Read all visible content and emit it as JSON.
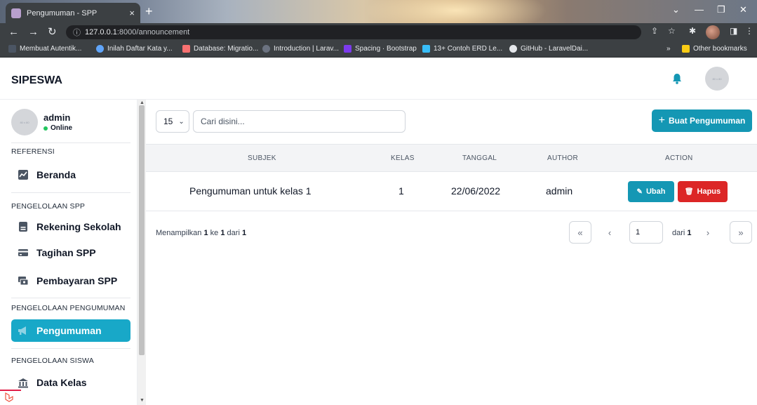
{
  "browser": {
    "tab_title": "Pengumuman - SPP",
    "tab_close": "×",
    "new_tab": "+",
    "url_host": "127.0.0.1",
    "url_path": ":8000/announcement",
    "bookmarks": [
      "Membuat Autentik...",
      "Inilah Daftar Kata y...",
      "Database: Migratio...",
      "Introduction | Larav...",
      "Spacing · Bootstrap",
      "13+ Contoh ERD Le...",
      "GitHub - LaravelDai..."
    ],
    "bookmarks_more": "»",
    "other_bookmarks": "Other bookmarks"
  },
  "app": {
    "brand": "SIPESWA",
    "avatar_text": "80 x 80"
  },
  "sidebar": {
    "user_name": "admin",
    "user_status": "Online",
    "sections": [
      {
        "title": "REFERENSI"
      },
      {
        "title": "PENGELOLAAN SPP"
      },
      {
        "title": "PENGELOLAAN PENGUMUMAN"
      },
      {
        "title": "PENGELOLAAN SISWA"
      }
    ],
    "items": [
      {
        "label": "Beranda",
        "icon": "chart-icon"
      },
      {
        "label": "Rekening Sekolah",
        "icon": "document-icon"
      },
      {
        "label": "Tagihan SPP",
        "icon": "card-icon"
      },
      {
        "label": "Pembayaran SPP",
        "icon": "payment-icon"
      },
      {
        "label": "Pengumuman",
        "icon": "megaphone-icon",
        "active": true
      },
      {
        "label": "Data Kelas",
        "icon": "bank-icon"
      }
    ]
  },
  "main": {
    "per_page": "15",
    "search_placeholder": "Cari disini...",
    "create_button": "Buat Pengumuman",
    "columns": [
      "SUBJEK",
      "KELAS",
      "TANGGAL",
      "AUTHOR",
      "ACTION"
    ],
    "rows": [
      {
        "subjek": "Pengumuman untuk kelas 1",
        "kelas": "1",
        "tanggal": "22/06/2022",
        "author": "admin"
      }
    ],
    "edit_label": "Ubah",
    "delete_label": "Hapus",
    "info_prefix": "Menampilkan",
    "info_from": "1",
    "info_ke": "ke",
    "info_to": "1",
    "info_dari": "dari",
    "info_total": "1",
    "page_input": "1",
    "page_of_label": "dari",
    "page_total": "1"
  },
  "colors": {
    "accent": "#1497b4",
    "active_nav": "#18a8c8",
    "danger": "#dc2626",
    "bell": "#1497b4",
    "online": "#22c55e"
  }
}
